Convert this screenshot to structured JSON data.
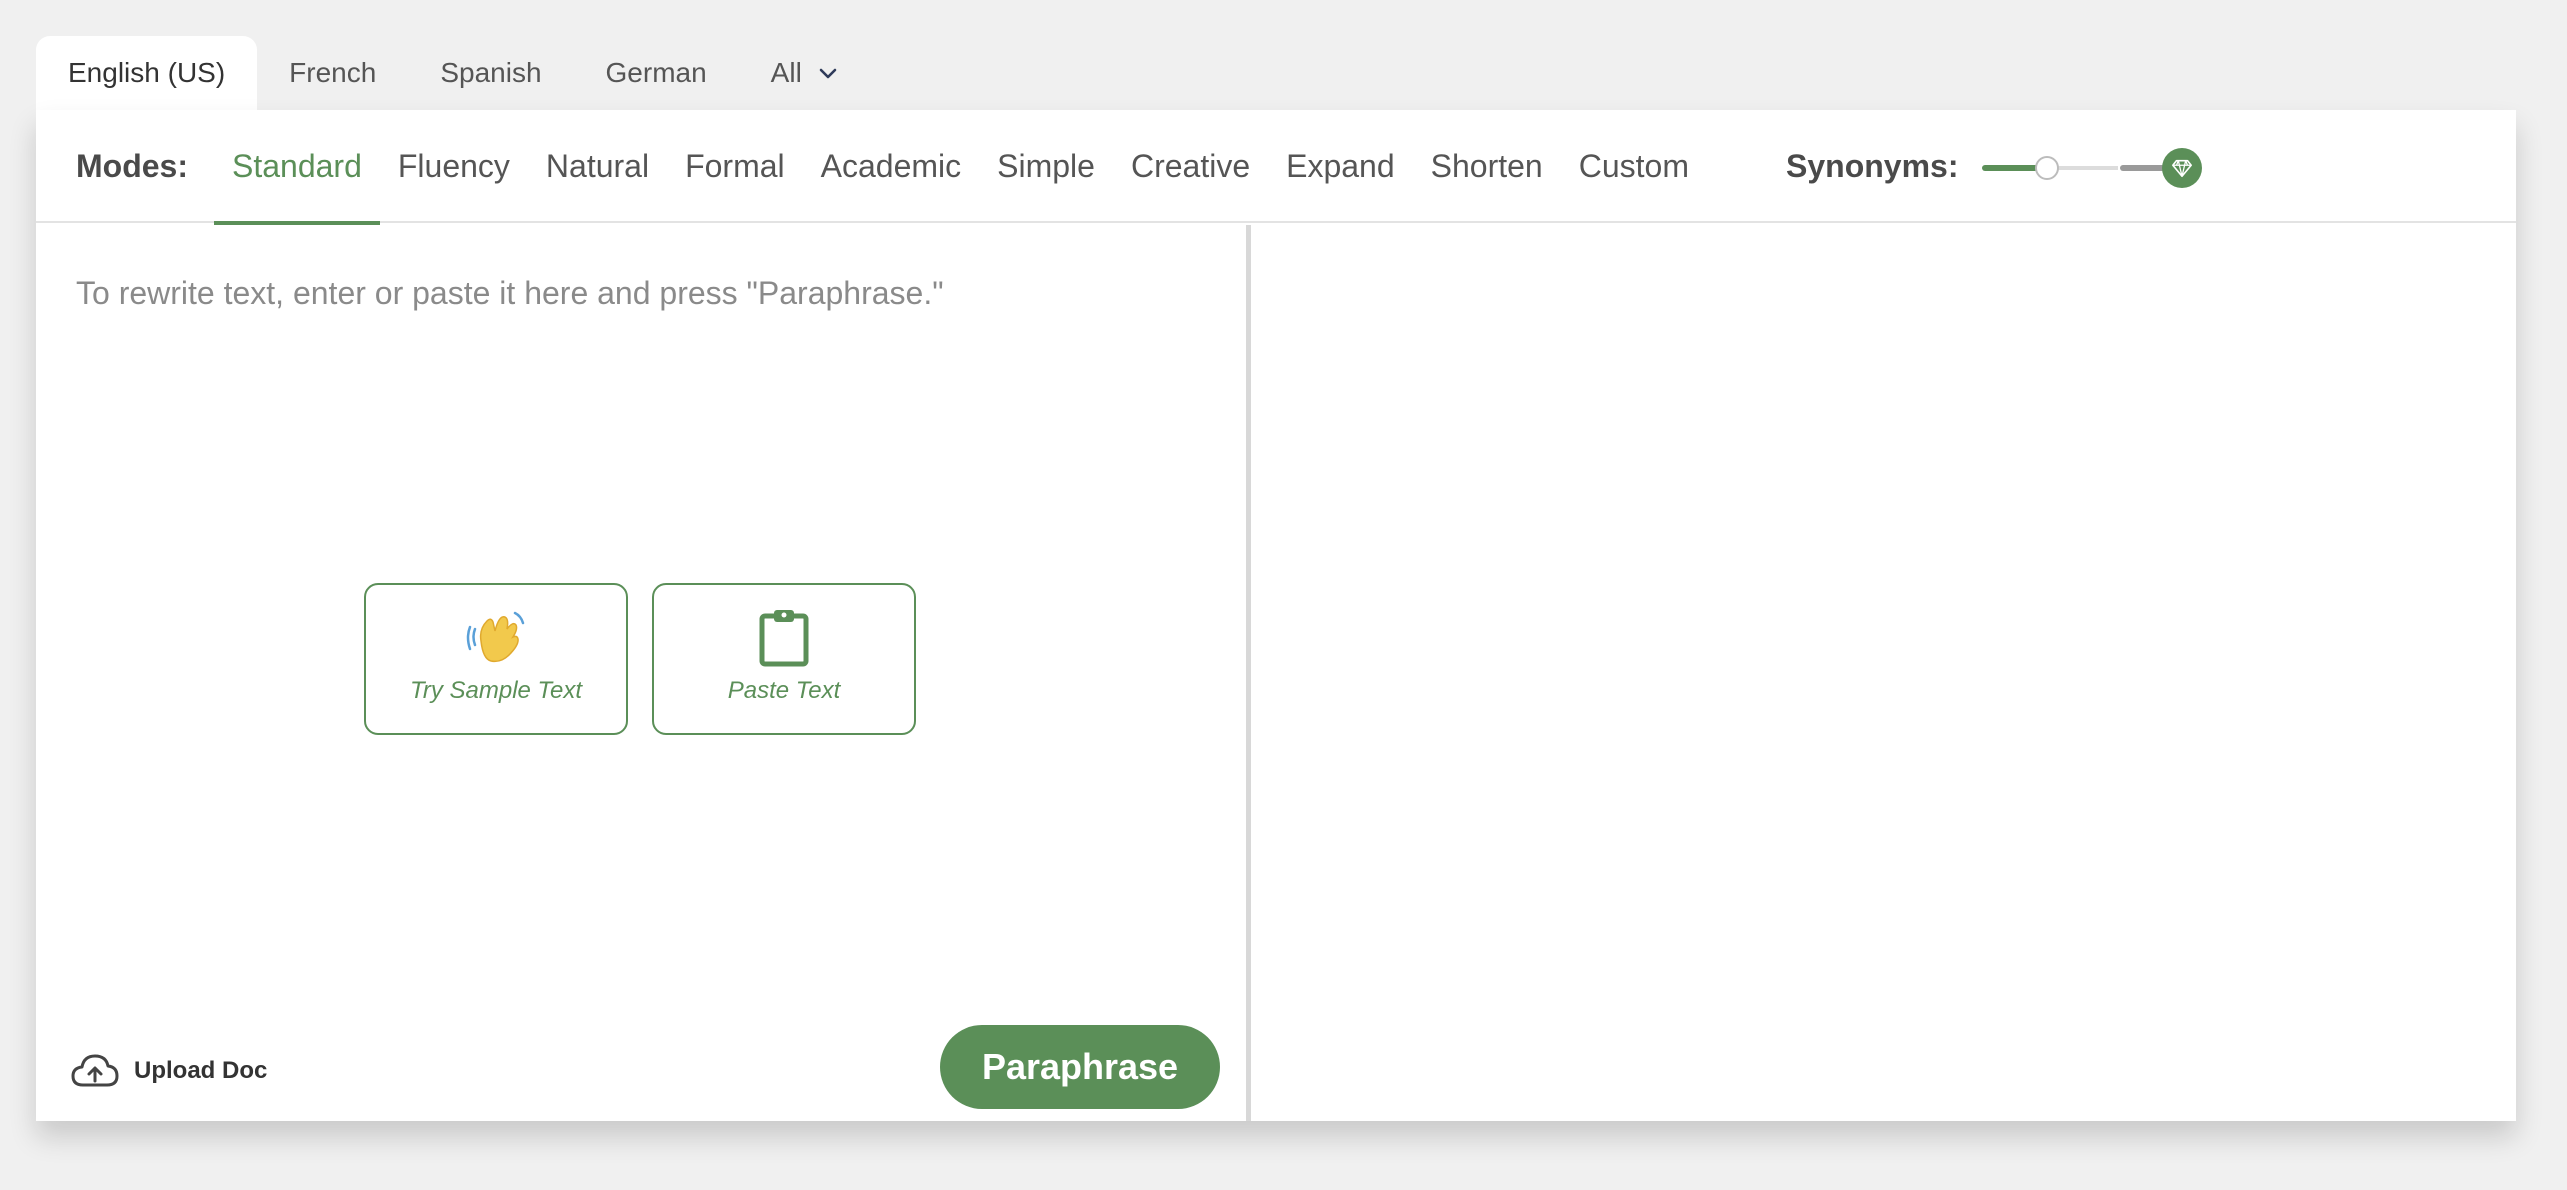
{
  "languages": {
    "tabs": [
      {
        "label": "English (US)",
        "active": true
      },
      {
        "label": "French",
        "active": false
      },
      {
        "label": "Spanish",
        "active": false
      },
      {
        "label": "German",
        "active": false
      },
      {
        "label": "All",
        "active": false
      }
    ],
    "all_icon": "chevron-down-icon"
  },
  "modes": {
    "label": "Modes:",
    "items": [
      {
        "label": "Standard",
        "active": true
      },
      {
        "label": "Fluency",
        "active": false
      },
      {
        "label": "Natural",
        "active": false
      },
      {
        "label": "Formal",
        "active": false
      },
      {
        "label": "Academic",
        "active": false
      },
      {
        "label": "Simple",
        "active": false
      },
      {
        "label": "Creative",
        "active": false
      },
      {
        "label": "Expand",
        "active": false
      },
      {
        "label": "Shorten",
        "active": false
      },
      {
        "label": "Custom",
        "active": false
      }
    ]
  },
  "synonyms": {
    "label": "Synonyms:",
    "level_fraction": 0.3,
    "premium_icon": "diamond-icon"
  },
  "editor": {
    "placeholder": "To rewrite text, enter or paste it here and press \"Paraphrase.\"",
    "sample_button": {
      "label": "Try Sample Text",
      "icon": "waving-hand-icon"
    },
    "paste_button": {
      "label": "Paste Text",
      "icon": "clipboard-icon"
    },
    "upload": {
      "label": "Upload Doc",
      "icon": "cloud-upload-icon"
    },
    "paraphrase_label": "Paraphrase"
  },
  "colors": {
    "accent": "#5b8f58",
    "background": "#f0f0f0"
  }
}
